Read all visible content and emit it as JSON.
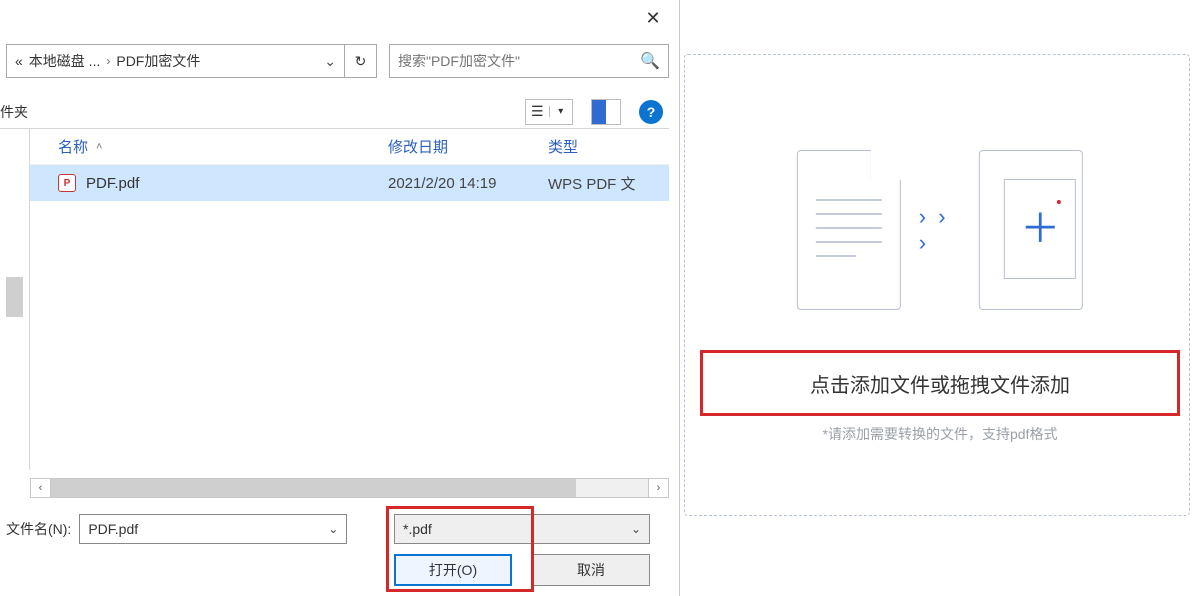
{
  "dialog": {
    "breadcrumb": {
      "prefix": "«",
      "d1": "本地磁盘 ...",
      "sep": "›",
      "d2": "PDF加密文件"
    },
    "search_placeholder": "搜索\"PDF加密文件\"",
    "toolbar_left": "件夹",
    "columns": {
      "name": "名称",
      "date": "修改日期",
      "type": "类型"
    },
    "file": {
      "name": "PDF.pdf",
      "date": "2021/2/20 14:19",
      "type": "WPS PDF 文"
    },
    "filename_label": "文件名(N):",
    "filename_value": "PDF.pdf",
    "filetype_value": "*.pdf",
    "open_btn": "打开(O)",
    "cancel_btn": "取消"
  },
  "dropzone": {
    "main_label": "点击添加文件或拖拽文件添加",
    "hint": "*请添加需要转换的文件，支持pdf格式"
  }
}
